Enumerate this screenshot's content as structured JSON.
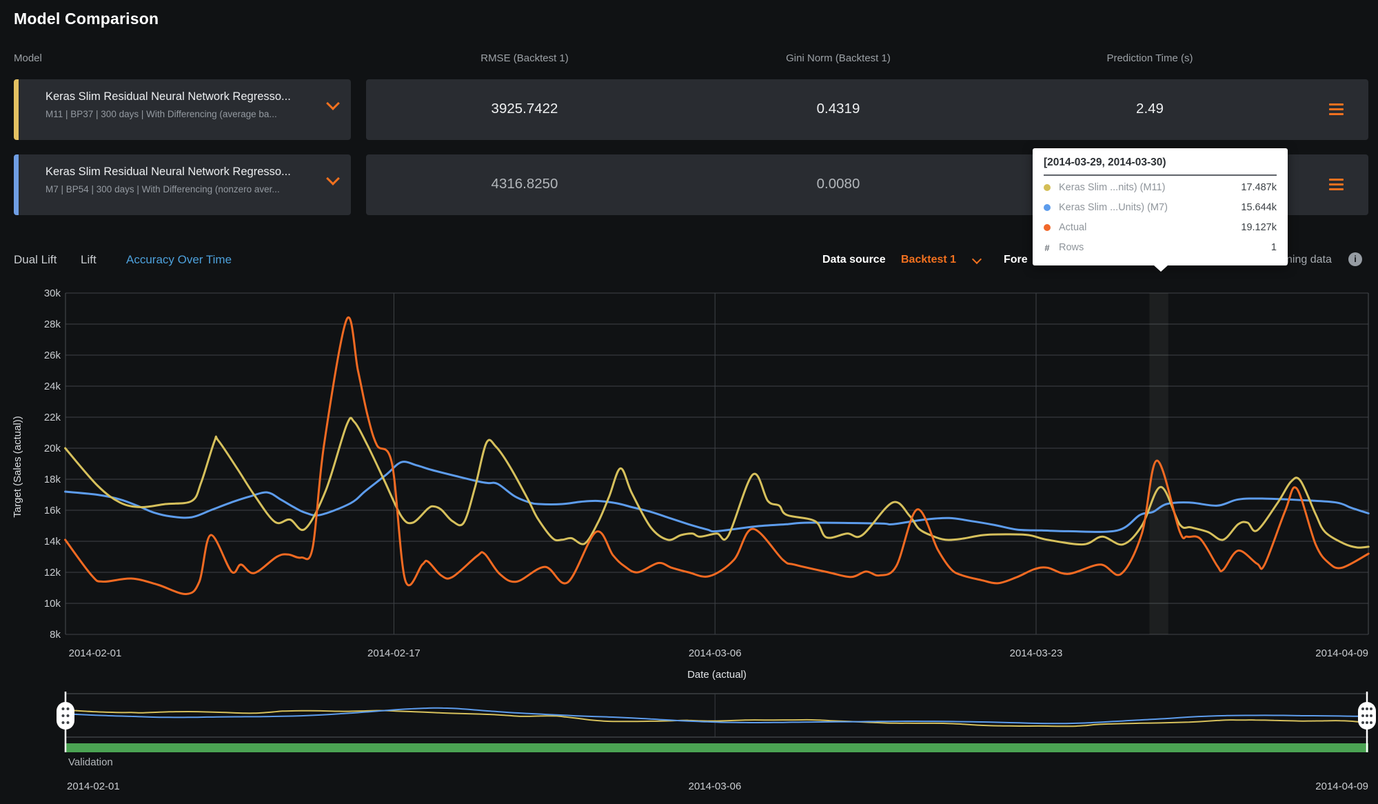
{
  "page_title": "Model Comparison",
  "colors": {
    "accent_orange": "#f2711f",
    "tab_active_blue": "#4da0db",
    "series_m11_yellow": "#d6c05c",
    "series_m7_blue": "#5d9cec",
    "series_actual_orange": "#f26a22",
    "validation_green": "#4ba353",
    "card_bg": "#292c31",
    "page_bg": "#101214"
  },
  "table": {
    "columns": [
      "Model",
      "RMSE (Backtest 1)",
      "Gini Norm (Backtest 1)",
      "Prediction Time (s)"
    ],
    "rows": [
      {
        "title": "Keras Slim Residual Neural Network Regresso...",
        "subtitle": "M11 | BP37 | 300 days | With Differencing (average ba...",
        "accent": "#e3c162",
        "values": [
          "3925.7422",
          "0.4319",
          "2.49"
        ],
        "value_color": "#eef0f1"
      },
      {
        "title": "Keras Slim Residual Neural Network Regresso...",
        "subtitle": "M7 | BP54 | 300 days | With Differencing (nonzero aver...",
        "accent": "#6f9ee4",
        "values": [
          "4316.8250",
          "0.0080",
          ""
        ],
        "value_color": "#b2b6ba"
      }
    ]
  },
  "tabs": [
    {
      "label": "Dual Lift",
      "active": false
    },
    {
      "label": "Lift",
      "active": false
    },
    {
      "label": "Accuracy Over Time",
      "active": true
    }
  ],
  "controls": {
    "data_source_label": "Data source",
    "data_source_value": "Backtest 1",
    "partial_left_text": "Fore",
    "partial_right_text": "ning data",
    "info_icon_glyph": "i"
  },
  "tooltip": {
    "title": "[2014-03-29, 2014-03-30)",
    "rows": [
      {
        "dot": "#d4be56",
        "label": "Keras Slim ...nits) (M11)",
        "value": "17.487k"
      },
      {
        "dot": "#5d9cec",
        "label": "Keras Slim ...Units) (M7)",
        "value": "15.644k"
      },
      {
        "dot": "#f1682a",
        "label": "Actual",
        "value": "19.127k"
      },
      {
        "dot": "#",
        "label": "Rows",
        "value": "1"
      }
    ]
  },
  "chart_data": {
    "type": "line",
    "title": "Accuracy Over Time",
    "xlabel": "Date (actual)",
    "ylabel": "Target (Sales (actual))",
    "units": "thousands (k)",
    "ylim": [
      8,
      30
    ],
    "y_ticks": [
      8,
      10,
      12,
      14,
      16,
      18,
      20,
      22,
      24,
      26,
      28,
      30
    ],
    "x_ticks": [
      {
        "day": 0,
        "label": "2014-02-01"
      },
      {
        "day": 16,
        "label": "2014-02-17"
      },
      {
        "day": 33,
        "label": "2014-03-06"
      },
      {
        "day": 50,
        "label": "2014-03-23"
      },
      {
        "day": 67,
        "label": "2014-04-09"
      }
    ],
    "x_domain_days": [
      -1.4,
      67.6
    ],
    "hover_band_days": [
      56,
      57
    ],
    "grid": true,
    "legend_position": "tooltip-only",
    "series": [
      {
        "name": "Keras Slim ...nits) (M11)",
        "color": "#d6c05c",
        "points": [
          [
            -1.4,
            20.0
          ],
          [
            0.3,
            17.6
          ],
          [
            1.5,
            16.5
          ],
          [
            2.6,
            16.2
          ],
          [
            3.9,
            16.4
          ],
          [
            5.3,
            16.6
          ],
          [
            5.8,
            17.8
          ],
          [
            6.5,
            20.45
          ],
          [
            6.7,
            20.5
          ],
          [
            7.7,
            18.7
          ],
          [
            8.6,
            17.0
          ],
          [
            9.7,
            15.25
          ],
          [
            10.5,
            15.4
          ],
          [
            11.3,
            14.8
          ],
          [
            12.4,
            17.3
          ],
          [
            13.5,
            21.5
          ],
          [
            13.9,
            21.7
          ],
          [
            14.6,
            20.2
          ],
          [
            15.5,
            17.9
          ],
          [
            16.4,
            15.6
          ],
          [
            17.0,
            15.2
          ],
          [
            17.8,
            16.1
          ],
          [
            18.1,
            16.25
          ],
          [
            18.5,
            16.05
          ],
          [
            19.1,
            15.3
          ],
          [
            19.7,
            15.2
          ],
          [
            20.3,
            17.5
          ],
          [
            20.9,
            20.35
          ],
          [
            21.4,
            20.1
          ],
          [
            22.1,
            18.9
          ],
          [
            23.1,
            16.7
          ],
          [
            23.6,
            15.5
          ],
          [
            24.4,
            14.2
          ],
          [
            24.9,
            14.1
          ],
          [
            25.4,
            14.2
          ],
          [
            26.1,
            13.85
          ],
          [
            26.8,
            15.2
          ],
          [
            27.4,
            16.9
          ],
          [
            28.0,
            18.7
          ],
          [
            28.6,
            17.1
          ],
          [
            29.6,
            14.9
          ],
          [
            30.5,
            14.1
          ],
          [
            31.2,
            14.4
          ],
          [
            31.8,
            14.5
          ],
          [
            32.2,
            14.3
          ],
          [
            33.1,
            14.5
          ],
          [
            33.7,
            14.35
          ],
          [
            35.0,
            18.3
          ],
          [
            35.8,
            16.6
          ],
          [
            36.4,
            16.3
          ],
          [
            36.8,
            15.7
          ],
          [
            38.3,
            15.3
          ],
          [
            38.9,
            14.25
          ],
          [
            40.0,
            14.5
          ],
          [
            40.8,
            14.4
          ],
          [
            42.4,
            16.5
          ],
          [
            43.3,
            15.65
          ],
          [
            43.8,
            14.8
          ],
          [
            44.5,
            14.35
          ],
          [
            45.2,
            14.1
          ],
          [
            46.0,
            14.15
          ],
          [
            47.2,
            14.4
          ],
          [
            48.4,
            14.45
          ],
          [
            49.6,
            14.4
          ],
          [
            50.6,
            14.1
          ],
          [
            52.5,
            13.8
          ],
          [
            53.5,
            14.3
          ],
          [
            54.6,
            13.8
          ],
          [
            55.6,
            15.0
          ],
          [
            56.6,
            17.5
          ],
          [
            57.6,
            15.1
          ],
          [
            58.2,
            14.9
          ],
          [
            59.1,
            14.6
          ],
          [
            59.9,
            14.1
          ],
          [
            60.7,
            15.1
          ],
          [
            61.2,
            15.2
          ],
          [
            61.7,
            14.7
          ],
          [
            62.8,
            16.5
          ],
          [
            63.5,
            17.85
          ],
          [
            64.0,
            17.9
          ],
          [
            64.8,
            15.75
          ],
          [
            65.3,
            14.6
          ],
          [
            66.3,
            13.85
          ],
          [
            67.0,
            13.6
          ],
          [
            67.6,
            13.65
          ]
        ]
      },
      {
        "name": "Keras Slim ...Units) (M7)",
        "color": "#5d9cec",
        "points": [
          [
            -1.4,
            17.2
          ],
          [
            0.3,
            17.0
          ],
          [
            1.5,
            16.7
          ],
          [
            2.5,
            16.25
          ],
          [
            3.3,
            15.85
          ],
          [
            4.2,
            15.6
          ],
          [
            5.3,
            15.55
          ],
          [
            6.4,
            16.05
          ],
          [
            7.5,
            16.55
          ],
          [
            8.4,
            16.9
          ],
          [
            9.3,
            17.15
          ],
          [
            10.0,
            16.7
          ],
          [
            10.7,
            16.2
          ],
          [
            11.3,
            15.85
          ],
          [
            12.1,
            15.7
          ],
          [
            13.7,
            16.45
          ],
          [
            14.5,
            17.25
          ],
          [
            15.6,
            18.3
          ],
          [
            16.4,
            19.1
          ],
          [
            17.2,
            18.9
          ],
          [
            18.0,
            18.6
          ],
          [
            19.3,
            18.2
          ],
          [
            20.5,
            17.85
          ],
          [
            21.0,
            17.75
          ],
          [
            21.5,
            17.7
          ],
          [
            22.4,
            16.9
          ],
          [
            23.2,
            16.5
          ],
          [
            23.7,
            16.4
          ],
          [
            24.9,
            16.4
          ],
          [
            25.9,
            16.55
          ],
          [
            26.8,
            16.6
          ],
          [
            27.8,
            16.45
          ],
          [
            28.6,
            16.2
          ],
          [
            29.6,
            15.9
          ],
          [
            30.6,
            15.5
          ],
          [
            31.6,
            15.1
          ],
          [
            32.6,
            14.75
          ],
          [
            33.1,
            14.65
          ],
          [
            35.1,
            14.95
          ],
          [
            36.8,
            15.1
          ],
          [
            38.0,
            15.2
          ],
          [
            41.7,
            15.15
          ],
          [
            42.4,
            15.1
          ],
          [
            44.1,
            15.4
          ],
          [
            45.4,
            15.5
          ],
          [
            46.6,
            15.3
          ],
          [
            47.8,
            15.05
          ],
          [
            49.0,
            14.75
          ],
          [
            50.3,
            14.7
          ],
          [
            51.7,
            14.65
          ],
          [
            54.3,
            14.7
          ],
          [
            55.5,
            15.7
          ],
          [
            56.2,
            15.9
          ],
          [
            56.9,
            16.4
          ],
          [
            58.1,
            16.5
          ],
          [
            59.6,
            16.3
          ],
          [
            60.7,
            16.7
          ],
          [
            62.1,
            16.75
          ],
          [
            64.1,
            16.65
          ],
          [
            65.9,
            16.5
          ],
          [
            66.7,
            16.15
          ],
          [
            67.6,
            15.8
          ]
        ]
      },
      {
        "name": "Actual",
        "color": "#f26a22",
        "points": [
          [
            -1.4,
            14.1
          ],
          [
            0.0,
            11.8
          ],
          [
            0.6,
            11.4
          ],
          [
            2.1,
            11.6
          ],
          [
            3.5,
            11.2
          ],
          [
            5.0,
            10.6
          ],
          [
            5.7,
            11.4
          ],
          [
            6.3,
            14.4
          ],
          [
            7.4,
            12.05
          ],
          [
            7.9,
            12.5
          ],
          [
            8.6,
            11.95
          ],
          [
            9.8,
            13.0
          ],
          [
            10.4,
            13.15
          ],
          [
            11.1,
            12.95
          ],
          [
            11.7,
            13.6
          ],
          [
            12.3,
            20.2
          ],
          [
            13.5,
            28.3
          ],
          [
            14.1,
            25.0
          ],
          [
            14.6,
            22.15
          ],
          [
            15.1,
            20.2
          ],
          [
            15.9,
            19.0
          ],
          [
            16.6,
            11.5
          ],
          [
            17.5,
            12.5
          ],
          [
            17.8,
            12.7
          ],
          [
            18.5,
            11.8
          ],
          [
            19.1,
            11.7
          ],
          [
            20.4,
            13.05
          ],
          [
            20.8,
            13.2
          ],
          [
            21.6,
            11.9
          ],
          [
            22.5,
            11.4
          ],
          [
            24.0,
            12.35
          ],
          [
            25.2,
            11.35
          ],
          [
            26.7,
            14.6
          ],
          [
            27.6,
            13.1
          ],
          [
            28.2,
            12.4
          ],
          [
            28.9,
            12.0
          ],
          [
            30.0,
            12.6
          ],
          [
            30.7,
            12.3
          ],
          [
            31.6,
            12.0
          ],
          [
            32.7,
            11.75
          ],
          [
            34.0,
            12.8
          ],
          [
            35.0,
            14.8
          ],
          [
            36.6,
            12.8
          ],
          [
            37.2,
            12.5
          ],
          [
            39.0,
            12.0
          ],
          [
            40.2,
            11.7
          ],
          [
            41.0,
            12.05
          ],
          [
            41.7,
            11.8
          ],
          [
            42.6,
            12.4
          ],
          [
            43.7,
            16.05
          ],
          [
            44.8,
            13.45
          ],
          [
            45.5,
            12.2
          ],
          [
            46.1,
            11.8
          ],
          [
            47.1,
            11.5
          ],
          [
            48.0,
            11.3
          ],
          [
            49.0,
            11.7
          ],
          [
            49.9,
            12.2
          ],
          [
            50.6,
            12.3
          ],
          [
            51.7,
            11.9
          ],
          [
            53.4,
            12.5
          ],
          [
            54.5,
            11.9
          ],
          [
            55.6,
            14.5
          ],
          [
            56.4,
            19.2
          ],
          [
            57.6,
            14.65
          ],
          [
            58.0,
            14.3
          ],
          [
            58.7,
            14.15
          ],
          [
            59.6,
            12.4
          ],
          [
            59.9,
            12.15
          ],
          [
            60.7,
            13.4
          ],
          [
            61.7,
            12.55
          ],
          [
            62.1,
            12.5
          ],
          [
            63.2,
            16.0
          ],
          [
            63.8,
            17.4
          ],
          [
            64.8,
            13.8
          ],
          [
            65.5,
            12.6
          ],
          [
            66.2,
            12.3
          ],
          [
            67.6,
            13.2
          ]
        ]
      }
    ]
  },
  "navigator": {
    "series_shown": [
      "Keras Slim ...nits) (M11)",
      "Keras Slim ...Units) (M7)"
    ],
    "validation_label": "Validation",
    "validation_color": "#4ba353",
    "x_labels": [
      "2014-02-01",
      "2014-03-06",
      "2014-04-09"
    ]
  }
}
